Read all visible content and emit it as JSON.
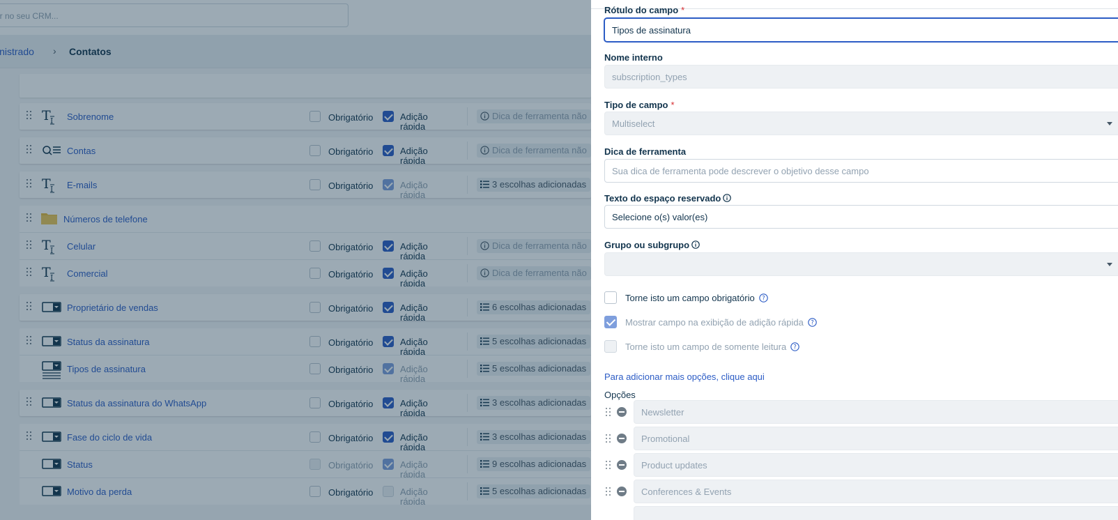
{
  "header": {
    "search_placeholder": "ar no seu CRM...",
    "breadcrumb": {
      "parent": "inistrado",
      "current": "Contatos"
    }
  },
  "fields": [
    {
      "name": "Sobrenome",
      "icon": "text-field-icon",
      "required_label": "Obrigatório",
      "required": false,
      "quick_label": "Adição rápida",
      "quick": true,
      "quick_disabled": false,
      "info": "Dica de ferramenta não",
      "info_kind": "tooltip"
    },
    {
      "name": "Contas",
      "icon": "lookup-field-icon",
      "required_label": "Obrigatório",
      "required": false,
      "quick_label": "Adição rápida",
      "quick": true,
      "quick_disabled": false,
      "info": "Dica de ferramenta não",
      "info_kind": "tooltip"
    },
    {
      "name": "E-mails",
      "icon": "text-field-icon",
      "required_label": "Obrigatório",
      "required": false,
      "quick_label": "Adição rápida",
      "quick": true,
      "quick_disabled": true,
      "info": "3 escolhas adicionadas",
      "info_kind": "choices"
    },
    {
      "name": "Números de telefone",
      "icon": "folder-icon",
      "group": true
    },
    {
      "name": "Celular",
      "icon": "text-field-icon",
      "required_label": "Obrigatório",
      "required": false,
      "quick_label": "Adição rápida",
      "quick": true,
      "quick_disabled": false,
      "info": "Dica de ferramenta não",
      "info_kind": "tooltip"
    },
    {
      "name": "Comercial",
      "icon": "text-field-icon",
      "required_label": "Obrigatório",
      "required": false,
      "quick_label": "Adição rápida",
      "quick": true,
      "quick_disabled": false,
      "info": "Dica de ferramenta não",
      "info_kind": "tooltip"
    },
    {
      "name": "Proprietário de vendas",
      "icon": "dropdown-field-icon",
      "required_label": "Obrigatório",
      "required": false,
      "quick_label": "Adição rápida",
      "quick": true,
      "quick_disabled": false,
      "info": "6 escolhas adicionadas",
      "info_kind": "choices"
    },
    {
      "name": "Status da assinatura",
      "icon": "dropdown-field-icon",
      "required_label": "Obrigatório",
      "required": false,
      "quick_label": "Adição rápida",
      "quick": true,
      "quick_disabled": false,
      "info": "5 escolhas adicionadas",
      "info_kind": "choices"
    },
    {
      "name": "Tipos de assinatura",
      "icon": "multiselect-field-icon",
      "required_label": "Obrigatório",
      "required": false,
      "quick_label": "Adição rápida",
      "quick": true,
      "quick_disabled": true,
      "info": "5 escolhas adicionadas",
      "info_kind": "choices"
    },
    {
      "name": "Status da assinatura do WhatsApp",
      "icon": "dropdown-field-icon",
      "required_label": "Obrigatório",
      "required": false,
      "quick_label": "Adição rápida",
      "quick": true,
      "quick_disabled": false,
      "info": "3 escolhas adicionadas",
      "info_kind": "choices"
    },
    {
      "name": "Fase do ciclo de vida",
      "icon": "dropdown-field-icon",
      "required_label": "Obrigatório",
      "required": false,
      "quick_label": "Adição rápida",
      "quick": true,
      "quick_disabled": false,
      "info": "3 escolhas adicionadas",
      "info_kind": "choices"
    },
    {
      "name": "Status",
      "icon": "dropdown-field-icon",
      "required_label": "Obrigatório",
      "required": false,
      "required_disabled": true,
      "quick_label": "Adição rápida",
      "quick": true,
      "quick_disabled": true,
      "info": "9 escolhas adicionadas",
      "info_kind": "choices"
    },
    {
      "name": "Motivo da perda",
      "icon": "dropdown-field-icon",
      "required_label": "Obrigatório",
      "required": false,
      "quick_label": "Adição rápida",
      "quick": false,
      "quick_disabled": true,
      "info": "5 escolhas adicionadas",
      "info_kind": "choices"
    }
  ],
  "panel": {
    "label_title": "Rótulo do campo",
    "label_value": "Tipos de assinatura",
    "internal_title": "Nome interno",
    "internal_value": "subscription_types",
    "type_title": "Tipo de campo",
    "type_value": "Multiselect",
    "tooltip_title": "Dica de ferramenta",
    "tooltip_placeholder": "Sua dica de ferramenta pode descrever o objetivo desse campo",
    "placeholder_title": "Texto do espaço reservado",
    "placeholder_value": "Selecione o(s) valor(es)",
    "group_title": "Grupo ou subgrupo",
    "group_value": "",
    "required_star": "*",
    "check_required": "Torne isto um campo obrigatório",
    "check_required_on": false,
    "check_quick": "Mostrar campo na exibição de adição rápida",
    "check_quick_on": true,
    "check_readonly": "Torne isto um campo de somente leitura",
    "check_readonly_on": false,
    "add_options_link": "Para adicionar mais opções, clique aqui",
    "options_title": "Opções",
    "options": [
      "Newsletter",
      "Promotional",
      "Product updates",
      "Conferences & Events"
    ]
  },
  "colors": {
    "accent": "#2c5cc5",
    "required": "#d72d30",
    "folder": "#e6b83c",
    "overlay": "rgba(18,52,77,.42)"
  }
}
